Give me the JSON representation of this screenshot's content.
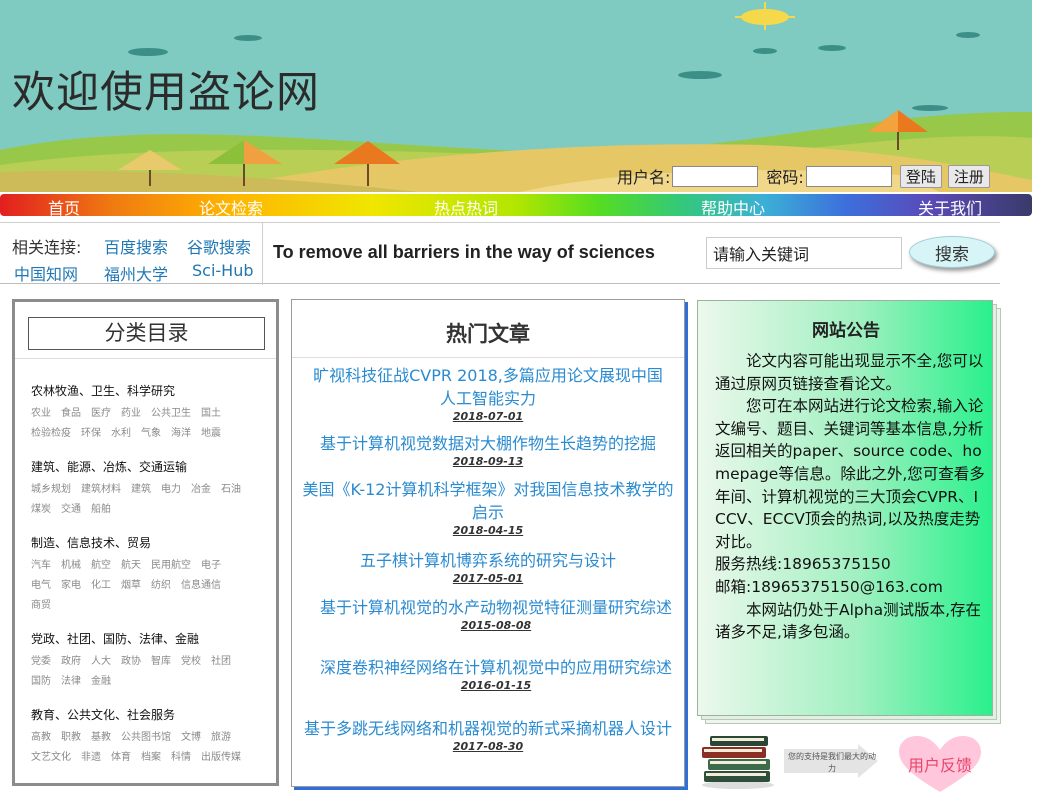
{
  "header": {
    "site_title": "欢迎使用盗论网",
    "login": {
      "username_label": "用户名:",
      "password_label": "密码:",
      "login_button": "登陆",
      "register_button": "注册"
    }
  },
  "nav": {
    "items": [
      "首页",
      "论文检索",
      "热点热词",
      "帮助中心",
      "关于我们"
    ]
  },
  "related_links": {
    "label": "相关连接:",
    "links": [
      "百度搜索",
      "谷歌搜索",
      "中国知网",
      "福州大学",
      "Sci-Hub"
    ]
  },
  "slogan": "To remove all barriers in the way of sciences",
  "search": {
    "value": "请输入关键词",
    "button": "搜索"
  },
  "categories": {
    "title": "分类目录",
    "groups": [
      {
        "heading": "农林牧渔、卫生、科学研究",
        "items": [
          "农业",
          "食品",
          "医疗",
          "药业",
          "公共卫生",
          "国土",
          "检验检疫",
          "环保",
          "水利",
          "气象",
          "海洋",
          "地震"
        ]
      },
      {
        "heading": "建筑、能源、冶炼、交通运输",
        "items": [
          "城乡规划",
          "建筑材料",
          "建筑",
          "电力",
          "冶金",
          "石油",
          "煤炭",
          "交通",
          "船舶"
        ]
      },
      {
        "heading": "制造、信息技术、贸易",
        "items": [
          "汽车",
          "机械",
          "航空",
          "航天",
          "民用航空",
          "电子",
          "电气",
          "家电",
          "化工",
          "烟草",
          "纺织",
          "信息通信",
          "商贸"
        ]
      },
      {
        "heading": "党政、社团、国防、法律、金融",
        "items": [
          "党委",
          "政府",
          "人大",
          "政协",
          "智库",
          "党校",
          "社团",
          "国防",
          "法律",
          "金融"
        ]
      },
      {
        "heading": "教育、公共文化、社会服务",
        "items": [
          "高教",
          "职教",
          "基教",
          "公共图书馆",
          "文博",
          "旅游",
          "文艺文化",
          "非遗",
          "体育",
          "档案",
          "科情",
          "出版传媒"
        ]
      }
    ]
  },
  "hot_articles": {
    "title": "热门文章",
    "items": [
      {
        "title": "旷视科技征战CVPR 2018,多篇应用论文展现中国人工智能实力",
        "date": "2018-07-01"
      },
      {
        "title": "基于计算机视觉数据对大棚作物生长趋势的挖掘",
        "date": "2018-09-13"
      },
      {
        "title": "美国《K-12计算机科学框架》对我国信息技术教学的启示",
        "date": "2018-04-15"
      },
      {
        "title": "五子棋计算机博弈系统的研究与设计",
        "date": "2017-05-01"
      },
      {
        "title": "基于计算机视觉的水产动物视觉特征测量研究综述",
        "date": "2015-08-08"
      },
      {
        "title": "深度卷积神经网络在计算机视觉中的应用研究综述",
        "date": "2016-01-15"
      },
      {
        "title": "基于多跳无线网络和机器视觉的新式采摘机器人设计",
        "date": "2017-08-30"
      }
    ]
  },
  "notice": {
    "title": "网站公告",
    "paragraphs": [
      "论文内容可能出现显示不全,您可以通过原网页链接查看论文。",
      "您可在本网站进行论文检索,输入论文编号、题目、关键词等基本信息,分析返回相关的paper、source code、homepage等信息。除此之外,您可查看多年间、计算机视觉的三大顶会CVPR、ICCV、ECCV顶会的热词,以及热度走势对比。",
      "服务热线:18965375150",
      "邮箱:18965375150@163.com",
      "本网站仍处于Alpha测试版本,存在诸多不足,请多包涵。"
    ]
  },
  "footer": {
    "support_text": "您的支持是我们最大的动力",
    "feedback": "用户反馈"
  },
  "colors": {
    "banner_sky": "#7fcbc1",
    "link_blue": "#1f78b4",
    "article_blue": "#2a8bd0",
    "notice_green": "#2af08c",
    "feedback_pink": "#e9456b"
  }
}
